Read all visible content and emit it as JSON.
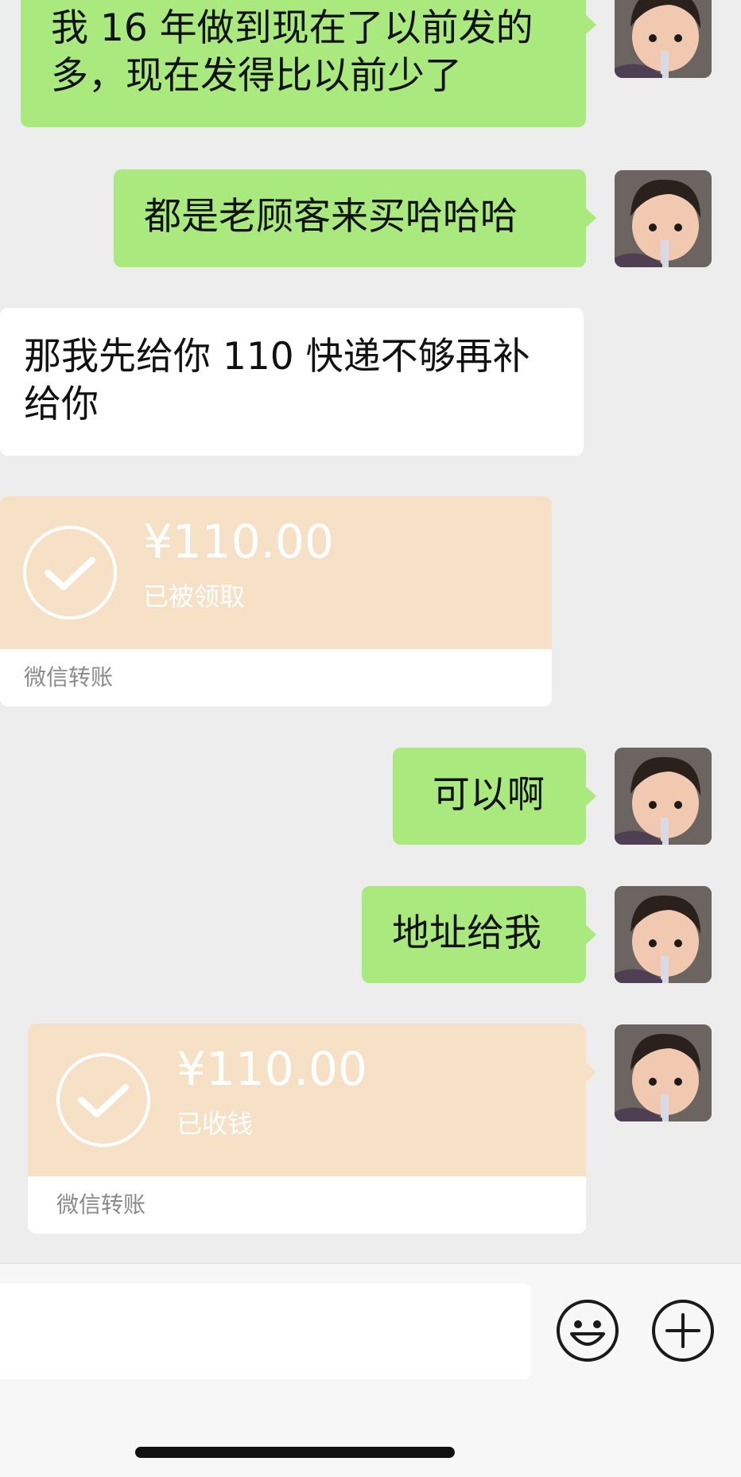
{
  "messages": [
    {
      "side": "right",
      "type": "text",
      "lines": [
        "我 16 年做到现在了以前发的",
        "多，现在发得比以前少了"
      ]
    },
    {
      "side": "right",
      "type": "text",
      "lines": [
        "都是老顾客来买哈哈哈"
      ]
    },
    {
      "side": "left",
      "type": "text",
      "lines": [
        "那我先给你 110 快递不够再补",
        "给你"
      ]
    },
    {
      "side": "left",
      "type": "transfer",
      "amount": "¥110.00",
      "status": "已被领取",
      "footer": "微信转账"
    },
    {
      "side": "right",
      "type": "text",
      "lines": [
        "可以啊"
      ]
    },
    {
      "side": "right",
      "type": "text",
      "lines": [
        "地址给我"
      ]
    },
    {
      "side": "right",
      "type": "transfer",
      "amount": "¥110.00",
      "status": "已收钱",
      "footer": "微信转账"
    }
  ],
  "input_bar": {
    "emoji_icon": "emoji-icon",
    "plus_icon": "plus-icon"
  },
  "colors": {
    "background": "#ededed",
    "bubble_self": "#a9e97e",
    "bubble_other": "#ffffff",
    "transfer": "#f6e1c6"
  }
}
